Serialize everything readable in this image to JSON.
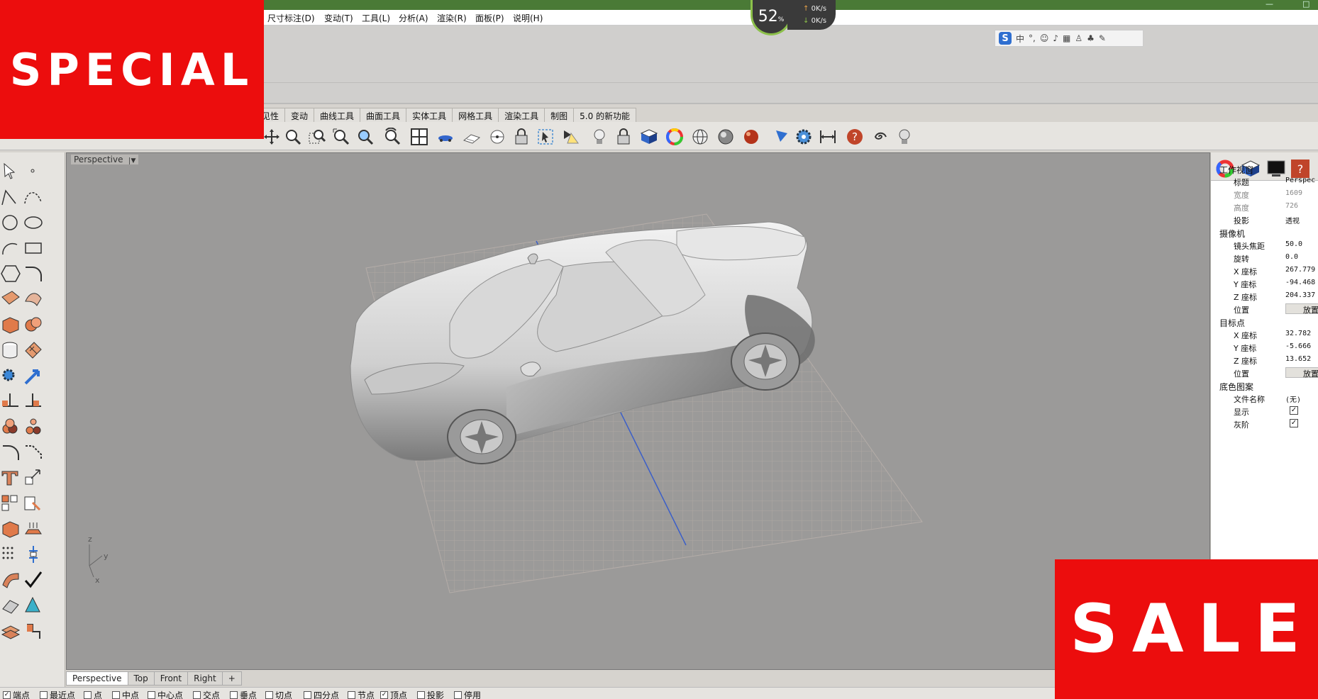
{
  "window": {
    "maximize_icon": "□"
  },
  "menu": [
    "尺寸标注(D)",
    "变动(T)",
    "工具(L)",
    "分析(A)",
    "渲染(R)",
    "面板(P)",
    "说明(H)"
  ],
  "perf_widget": {
    "percent": "52",
    "percent_unit": "%",
    "upload": "0K/s",
    "download": "0K/s"
  },
  "ime": {
    "logo": "S",
    "mode": "中",
    "punct": "°,"
  },
  "toolbar_tabs": [
    "见性",
    "变动",
    "曲线工具",
    "曲面工具",
    "实体工具",
    "网格工具",
    "渲染工具",
    "制图",
    "5.0 的新功能"
  ],
  "viewport": {
    "title": "Perspective",
    "axis_z": "z",
    "axis_y": "y",
    "axis_x": "x"
  },
  "viewport_tabs": [
    "Perspective",
    "Top",
    "Front",
    "Right",
    "+"
  ],
  "status_snaps": [
    {
      "label": "端点",
      "checked": true
    },
    {
      "label": "最近点",
      "checked": false
    },
    {
      "label": "点",
      "checked": false
    },
    {
      "label": "中点",
      "checked": false
    },
    {
      "label": "中心点",
      "checked": false
    },
    {
      "label": "交点",
      "checked": false
    },
    {
      "label": "垂点",
      "checked": false
    },
    {
      "label": "切点",
      "checked": false
    },
    {
      "label": "四分点",
      "checked": false
    },
    {
      "label": "节点",
      "checked": false
    },
    {
      "label": "顶点",
      "checked": true
    },
    {
      "label": "投影",
      "checked": false
    },
    {
      "label": "停用",
      "checked": false
    }
  ],
  "properties": {
    "section_viewport": "工作视窗",
    "title_label": "标题",
    "title_value": "Perspec",
    "width_label": "宽度",
    "width_value": "1609",
    "height_label": "高度",
    "height_value": "726",
    "projection_label": "投影",
    "projection_value": "透视",
    "section_camera": "摄像机",
    "lens_label": "镜头焦距",
    "lens_value": "50.0",
    "rotation_label": "旋转",
    "rotation_value": "0.0",
    "cam_x_label": "X 座标",
    "cam_x_value": "267.779",
    "cam_y_label": "Y 座标",
    "cam_y_value": "-94.468",
    "cam_z_label": "Z 座标",
    "cam_z_value": "204.337",
    "cam_pos_label": "位置",
    "cam_pos_btn": "放置",
    "section_target": "目标点",
    "tgt_x_label": "X 座标",
    "tgt_x_value": "32.782",
    "tgt_y_label": "Y 座标",
    "tgt_y_value": "-5.666",
    "tgt_z_label": "Z 座标",
    "tgt_z_value": "13.652",
    "tgt_pos_label": "位置",
    "tgt_pos_btn": "放置",
    "section_wallpaper": "底色图案",
    "filename_label": "文件名称",
    "filename_value": "(无)",
    "show_label": "显示",
    "show_checked": true,
    "gray_label": "灰阶",
    "gray_checked": true
  },
  "promo": {
    "top_left": "SPECIAL",
    "bottom_right": "SALE",
    "color": "#ec0d0d"
  }
}
